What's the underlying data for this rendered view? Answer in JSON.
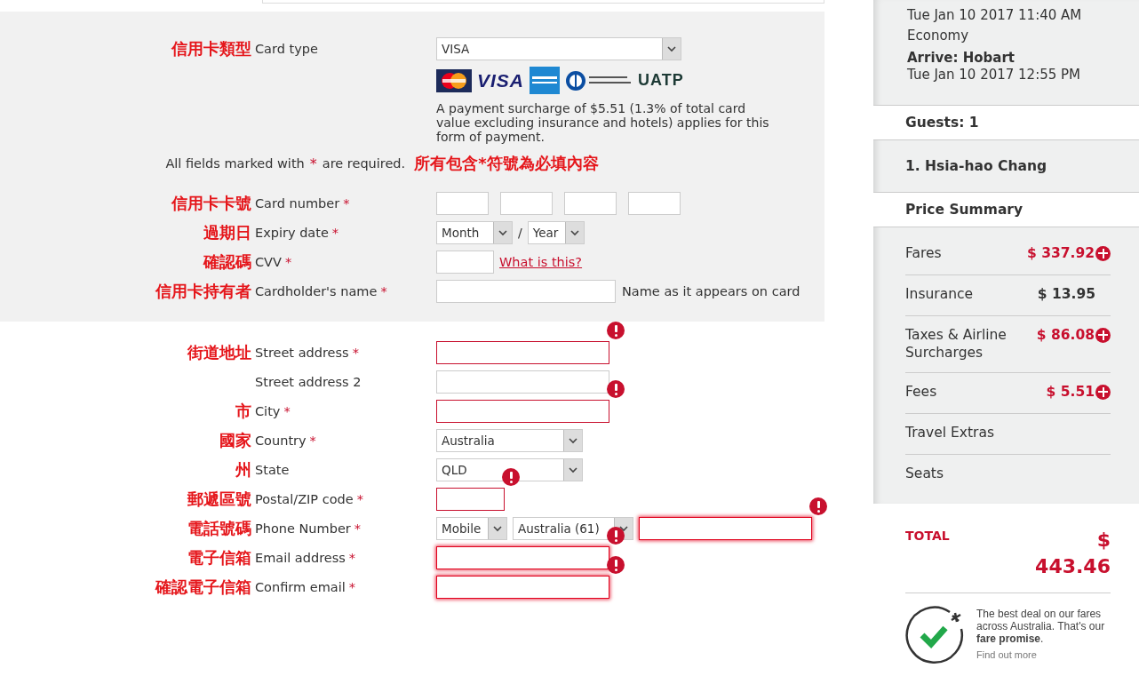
{
  "payment": {
    "rows": [
      {
        "annotation": "信用卡類型",
        "label": "Card type",
        "kind": "wide_select",
        "value": "VISA"
      },
      {
        "kind": "logos",
        "logos": [
          {
            "kind": "mastercard"
          },
          {
            "kind": "visa",
            "text": "VISA"
          },
          {
            "kind": "amex"
          },
          {
            "kind": "diners"
          },
          {
            "kind": "uatp",
            "text": "UATP"
          }
        ]
      },
      {
        "kind": "note",
        "text": "A payment surcharge of $5.51 (1.3% of total card value excluding insurance and hotels) applies for this form of payment."
      },
      {
        "kind": "required_note",
        "text": "All fields marked with",
        "mark": "*",
        "text_after": "are required.",
        "annotation": "所有包含*符號為必填內容"
      },
      {
        "annotation": "信用卡卡號",
        "label": "Card number",
        "required_mark": "*",
        "kind": "card_number"
      },
      {
        "annotation": "過期日",
        "label": "Expiry date",
        "required_mark": "*",
        "kind": "expiry",
        "month": "Month",
        "separator": "/",
        "year": "Year"
      },
      {
        "annotation": "確認碼",
        "label": "CVV",
        "required_mark": "*",
        "kind": "cvv",
        "link": "What is this?"
      },
      {
        "annotation": "信用卡持有者",
        "label": "Cardholder's name",
        "required_mark": "*",
        "kind": "text",
        "hint": "Name as it appears on card"
      }
    ]
  },
  "address": {
    "rows": [
      {
        "annotation": "街道地址",
        "label": "Street address",
        "required_mark": "*",
        "kind": "text",
        "error": true,
        "glow": false
      },
      {
        "label": "Street address 2",
        "kind": "text",
        "error": false,
        "glow": false
      },
      {
        "annotation": "市",
        "label": "City",
        "required_mark": "*",
        "kind": "text",
        "error": true,
        "glow": false
      },
      {
        "annotation": "國家",
        "label": "Country",
        "required_mark": "*",
        "kind": "select",
        "value": "Australia"
      },
      {
        "annotation": "州",
        "label": "State",
        "kind": "select",
        "value": "QLD"
      },
      {
        "annotation": "郵遞區號",
        "label": "Postal/ZIP code",
        "required_mark": "*",
        "kind": "short_text",
        "error": true,
        "glow": false
      },
      {
        "annotation": "電話號碼",
        "label": "Phone Number",
        "required_mark": "*",
        "kind": "phone",
        "type": "Mobile",
        "country": "Australia (61)",
        "error": true,
        "glow": true
      },
      {
        "annotation": "電子信箱",
        "label": "Email address",
        "required_mark": "*",
        "kind": "text",
        "error": true,
        "glow": true
      },
      {
        "annotation": "確認電子信箱",
        "label": "Confirm email",
        "required_mark": "*",
        "kind": "text",
        "error": true,
        "glow": true
      }
    ]
  },
  "sidebar": {
    "flight": [
      {
        "text": "Tue Jan 10 2017 11:40 AM",
        "bold": false
      },
      {
        "text": "Economy",
        "bold": false
      },
      {
        "text": "Arrive: Hobart",
        "bold": true
      },
      {
        "text": "Tue Jan 10 2017 12:55 PM",
        "bold": false
      }
    ],
    "guests": "Guests: 1",
    "passenger": "1. Hsia-hao Chang",
    "price_title": "Price Summary",
    "prices": [
      {
        "label": "Fares",
        "value": "$ 337.92",
        "expandable": true
      },
      {
        "label": "Insurance",
        "value": "$ 13.95",
        "expandable": false
      },
      {
        "label": "Taxes & Airline Surcharges",
        "value": "$ 86.08",
        "expandable": true
      },
      {
        "label": "Fees",
        "value": "$ 5.51",
        "expandable": true
      },
      {
        "label": "Travel Extras"
      },
      {
        "label": "Seats"
      }
    ],
    "total_label": "TOTAL",
    "total": "$ 443.46",
    "promise": {
      "text": "The best deal on our fares across Australia. That's our **fare promise**.",
      "link": "Find out more"
    }
  }
}
